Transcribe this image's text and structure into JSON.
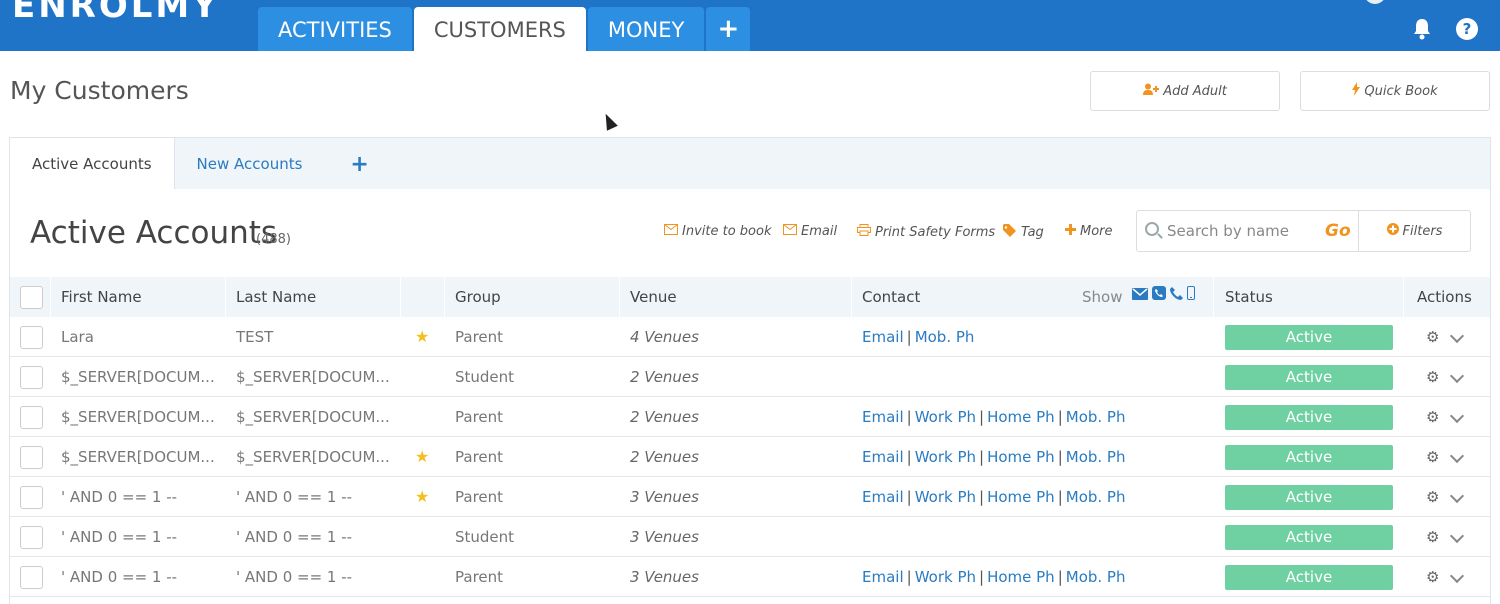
{
  "app": {
    "logo": "ENROLMY",
    "nav": [
      {
        "label": "ACTIVITIES"
      },
      {
        "label": "CUSTOMERS"
      },
      {
        "label": "MONEY"
      }
    ],
    "nav_plus": "+",
    "help_glyph": "?"
  },
  "page": {
    "title": "My Customers",
    "add_adult": "Add Adult",
    "quick_book": "Quick Book"
  },
  "subtabs": [
    {
      "label": "Active Accounts"
    },
    {
      "label": "New Accounts"
    }
  ],
  "subtab_plus": "+",
  "section": {
    "title": "Active Accounts",
    "count": "(488)"
  },
  "toolbar": {
    "invite": "Invite to book",
    "email": "Email",
    "print": "Print Safety Forms",
    "tag": "Tag",
    "more": "More"
  },
  "search": {
    "placeholder": "Search by name",
    "go": "Go",
    "filters": "Filters"
  },
  "table": {
    "headers": {
      "first_name": "First Name",
      "last_name": "Last Name",
      "group": "Group",
      "venue": "Venue",
      "contact": "Contact",
      "show": "Show",
      "status": "Status",
      "actions": "Actions"
    },
    "rows": [
      {
        "first": "Lara",
        "last": "TEST",
        "starred": true,
        "group": "Parent",
        "venue": "4 Venues",
        "contacts": [
          "Email",
          "Mob. Ph"
        ],
        "status": "Active"
      },
      {
        "first": "$_SERVER[DOCUM...",
        "last": "$_SERVER[DOCUM...",
        "starred": false,
        "group": "Student",
        "venue": "2 Venues",
        "contacts": [],
        "status": "Active"
      },
      {
        "first": "$_SERVER[DOCUM...",
        "last": "$_SERVER[DOCUM...",
        "starred": false,
        "group": "Parent",
        "venue": "2 Venues",
        "contacts": [
          "Email",
          "Work Ph",
          "Home Ph",
          "Mob. Ph"
        ],
        "status": "Active"
      },
      {
        "first": "$_SERVER[DOCUM...",
        "last": "$_SERVER[DOCUM...",
        "starred": true,
        "group": "Parent",
        "venue": "2 Venues",
        "contacts": [
          "Email",
          "Work Ph",
          "Home Ph",
          "Mob. Ph"
        ],
        "status": "Active"
      },
      {
        "first": "' AND 0 == 1 --",
        "last": "' AND 0 == 1 --",
        "starred": true,
        "group": "Parent",
        "venue": "3 Venues",
        "contacts": [
          "Email",
          "Work Ph",
          "Home Ph",
          "Mob. Ph"
        ],
        "status": "Active"
      },
      {
        "first": "' AND 0 == 1 --",
        "last": "' AND 0 == 1 --",
        "starred": false,
        "group": "Student",
        "venue": "3 Venues",
        "contacts": [],
        "status": "Active"
      },
      {
        "first": "' AND 0 == 1 --",
        "last": "' AND 0 == 1 --",
        "starred": false,
        "group": "Parent",
        "venue": "3 Venues",
        "contacts": [
          "Email",
          "Work Ph",
          "Home Ph",
          "Mob. Ph"
        ],
        "status": "Active"
      }
    ]
  },
  "colors": {
    "brand": "#1f74c8",
    "tab": "#2c8fe2",
    "accent": "#f0941f",
    "status_active": "#6fd1a2",
    "link": "#2a7bc1"
  }
}
